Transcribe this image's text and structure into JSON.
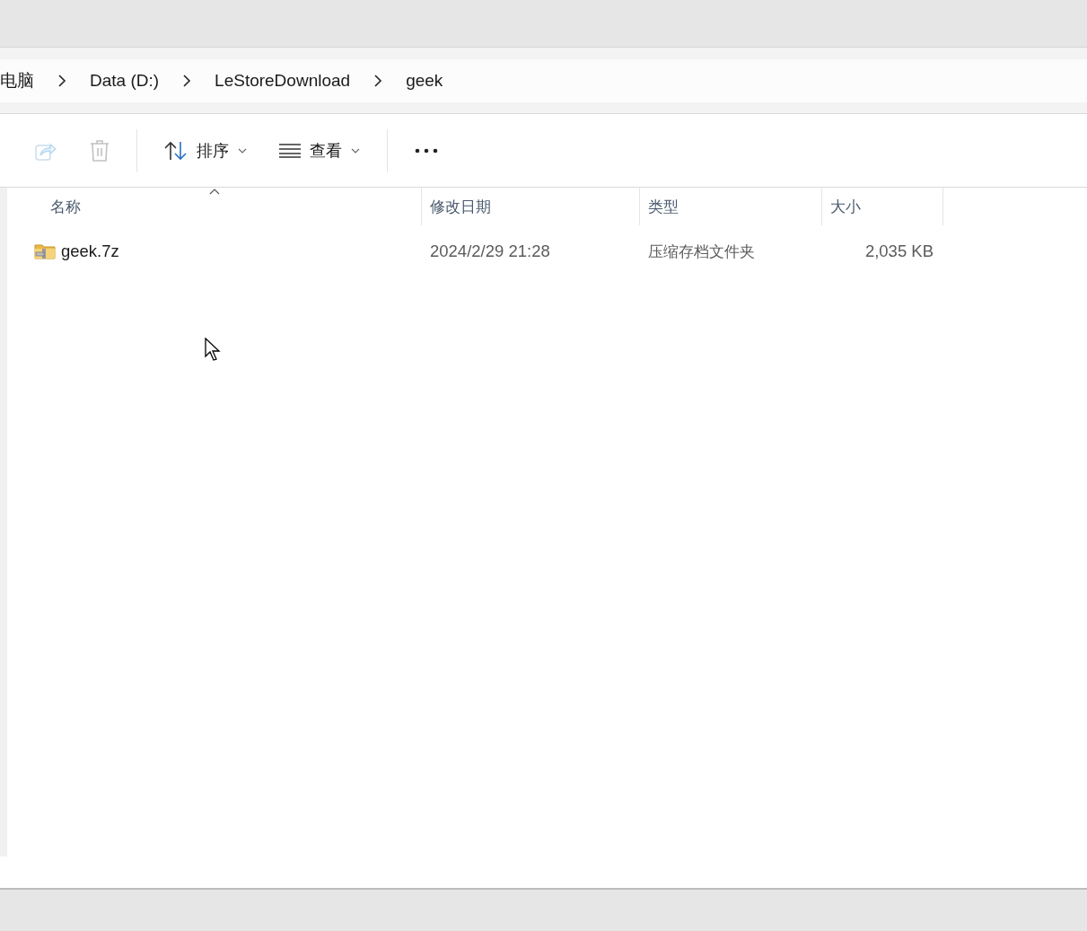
{
  "breadcrumb": [
    "电脑",
    "Data (D:)",
    "LeStoreDownload",
    "geek"
  ],
  "toolbar": [
    {
      "kind": "share",
      "disabled": true
    },
    {
      "kind": "delete",
      "disabled": true
    },
    {
      "kind": "separator"
    },
    {
      "kind": "sort",
      "label": "排序",
      "disabled": false
    },
    {
      "kind": "view",
      "label": "查看",
      "disabled": false
    },
    {
      "kind": "separator"
    },
    {
      "kind": "more",
      "disabled": false
    }
  ],
  "table": {
    "columns": [
      {
        "label": "名称",
        "sorted": true
      },
      {
        "label": "修改日期",
        "sorted": false
      },
      {
        "label": "类型",
        "sorted": false
      },
      {
        "label": "大小",
        "sorted": false
      }
    ],
    "rows": [
      {
        "name": "geek.7z",
        "date": "2024/2/29 21:28",
        "type": "压缩存档文件夹",
        "size": "2,035 KB",
        "selected": false
      }
    ]
  }
}
